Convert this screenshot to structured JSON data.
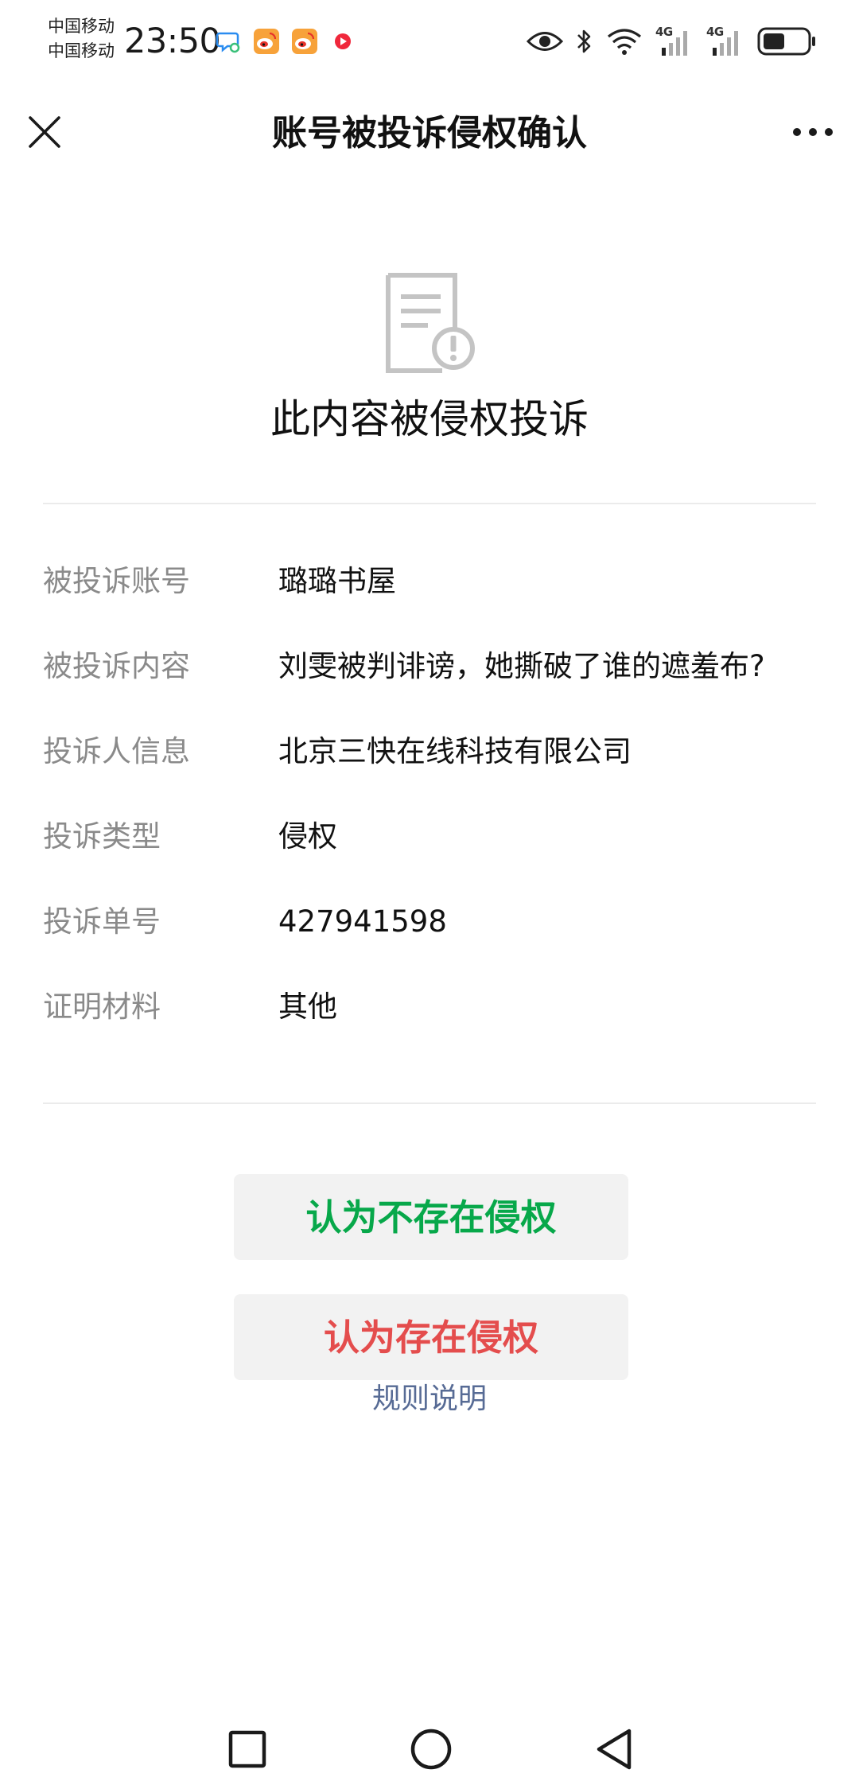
{
  "status_bar": {
    "carrier_1": "中国移动",
    "carrier_2": "中国移动",
    "time": "23:50",
    "network_1": "4G",
    "network_2": "4G",
    "notification_icons": [
      "chat-bubble-icon",
      "weibo-icon",
      "weibo-icon",
      "video-icon"
    ],
    "system_icons": [
      "eye-icon",
      "bluetooth-icon",
      "wifi-icon",
      "signal-icon",
      "signal-icon",
      "battery-icon"
    ]
  },
  "title_bar": {
    "title": "账号被投诉侵权确认",
    "close_icon": "close-icon",
    "more_icon": "more-icon"
  },
  "header": {
    "icon": "document-warning-icon",
    "headline": "此内容被侵权投诉"
  },
  "details": [
    {
      "label": "被投诉账号",
      "value": "璐璐书屋"
    },
    {
      "label": "被投诉内容",
      "value": "刘雯被判诽谤，她撕破了谁的遮羞布?"
    },
    {
      "label": "投诉人信息",
      "value": "北京三快在线科技有限公司"
    },
    {
      "label": "投诉类型",
      "value": "侵权"
    },
    {
      "label": "投诉单号",
      "value": "427941598"
    },
    {
      "label": "证明材料",
      "value": "其他"
    }
  ],
  "actions": {
    "not_infringe_label": "认为不存在侵权",
    "infringe_label": "认为存在侵权",
    "rules_label": "规则说明"
  },
  "colors": {
    "accent_green": "#07a84a",
    "accent_red": "#e44d4d",
    "link_blue": "#576b95",
    "label_gray": "#8a8a8a",
    "button_bg": "#f2f2f2"
  },
  "nav_bar": {
    "icons": [
      "recents-square-icon",
      "home-circle-icon",
      "back-triangle-icon"
    ]
  }
}
